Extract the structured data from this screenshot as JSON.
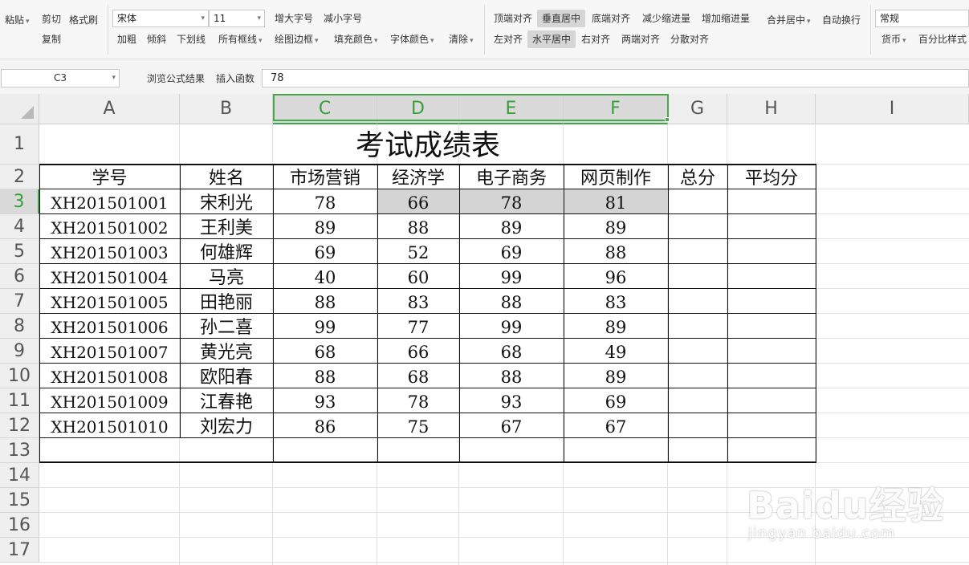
{
  "ribbon": {
    "paste": "粘贴",
    "cut": "剪切",
    "format_painter": "格式刷",
    "copy": "复制",
    "font_name": "宋体",
    "font_size": "11",
    "increase_font": "增大字号",
    "decrease_font": "减小字号",
    "bold": "加粗",
    "italic": "倾斜",
    "underline": "下划线",
    "all_borders": "所有框线",
    "draw_border": "绘图边框",
    "fill_color": "填充颜色",
    "font_color": "字体颜色",
    "clear": "清除",
    "align_top": "顶端对齐",
    "align_middle": "垂直居中",
    "align_bottom": "底端对齐",
    "decrease_indent": "减少缩进量",
    "increase_indent": "增加缩进量",
    "merge_center": "合并居中",
    "wrap_text": "自动换行",
    "align_left": "左对齐",
    "align_center": "水平居中",
    "align_right": "右对齐",
    "align_justify": "两端对齐",
    "align_distributed": "分散对齐",
    "number_format": "常规",
    "currency": "货币",
    "percent_style": "百分比样式"
  },
  "formula_bar": {
    "cell_ref": "C3",
    "view_formula_result": "浏览公式结果",
    "insert_function": "插入函数",
    "formula_value": "78"
  },
  "sheet": {
    "columns": [
      "A",
      "B",
      "C",
      "D",
      "E",
      "F",
      "G",
      "H",
      "I"
    ],
    "rows": [
      "1",
      "2",
      "3",
      "4",
      "5",
      "6",
      "7",
      "8",
      "9",
      "10",
      "11",
      "12",
      "13",
      "14",
      "15",
      "16",
      "17"
    ],
    "selected_cell": "C3",
    "title": "考试成绩表",
    "headers": [
      "学号",
      "姓名",
      "市场营销",
      "经济学",
      "电子商务",
      "网页制作",
      "总分",
      "平均分"
    ],
    "records": [
      [
        "XH201501001",
        "宋利光",
        "78",
        "66",
        "78",
        "81"
      ],
      [
        "XH201501002",
        "王利美",
        "89",
        "88",
        "89",
        "89"
      ],
      [
        "XH201501003",
        "何雄辉",
        "69",
        "52",
        "69",
        "88"
      ],
      [
        "XH201501004",
        "马亮",
        "40",
        "60",
        "99",
        "96"
      ],
      [
        "XH201501005",
        "田艳丽",
        "88",
        "83",
        "88",
        "83"
      ],
      [
        "XH201501006",
        "孙二喜",
        "99",
        "77",
        "99",
        "89"
      ],
      [
        "XH201501007",
        "黄光亮",
        "68",
        "66",
        "68",
        "49"
      ],
      [
        "XH201501008",
        "欧阳春",
        "88",
        "68",
        "88",
        "89"
      ],
      [
        "XH201501009",
        "江春艳",
        "93",
        "78",
        "93",
        "69"
      ],
      [
        "XH201501010",
        "刘宏力",
        "86",
        "75",
        "67",
        "67"
      ]
    ]
  },
  "watermark": {
    "brand": "Baidu经验",
    "url": "jingyan.baidu.com"
  },
  "colors": {
    "selection": "#4aa84a",
    "selected_header": "#3a9d3a",
    "shade": "#d4d4d4"
  }
}
